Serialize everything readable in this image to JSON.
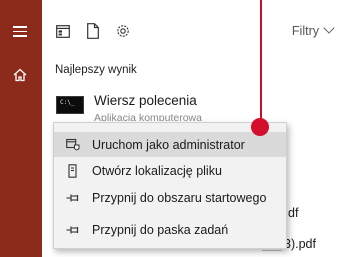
{
  "toolbar": {
    "filters_label": "Filtry"
  },
  "results": {
    "section_title": "Najlepszy wynik",
    "best": {
      "title": "Wiersz polecenia",
      "subtitle": "Aplikacja komputerowa",
      "icon_prompt": "C:\\_"
    },
    "behind_items": [
      {
        "label": "df"
      },
      {
        "label": "3).pdf"
      }
    ]
  },
  "context_menu": {
    "items": [
      {
        "label": "Uruchom jako administrator",
        "icon": "shield-run-icon",
        "active": true
      },
      {
        "label": "Otwórz lokalizację pliku",
        "icon": "file-location-icon",
        "active": false
      },
      {
        "label": "Przypnij do obszaru startowego",
        "icon": "pin-icon",
        "active": false
      },
      {
        "label": "Przypnij do paska zadań",
        "icon": "pin-icon",
        "active": false
      }
    ]
  },
  "colors": {
    "rail": "#8c2a1c",
    "menu_background": "#f2f2f2",
    "menu_hover": "#dadada",
    "annotation": "#c8102e"
  }
}
